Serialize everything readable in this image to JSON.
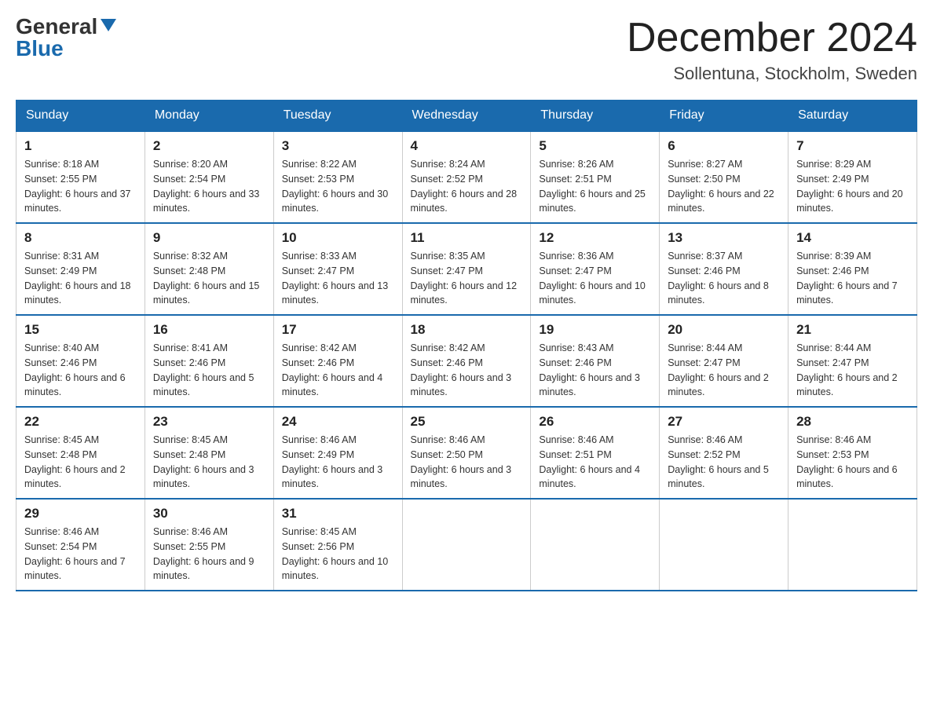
{
  "header": {
    "logo_general": "General",
    "logo_blue": "Blue",
    "month_title": "December 2024",
    "location": "Sollentuna, Stockholm, Sweden"
  },
  "weekdays": [
    "Sunday",
    "Monday",
    "Tuesday",
    "Wednesday",
    "Thursday",
    "Friday",
    "Saturday"
  ],
  "weeks": [
    [
      {
        "day": "1",
        "sunrise": "8:18 AM",
        "sunset": "2:55 PM",
        "daylight": "6 hours and 37 minutes."
      },
      {
        "day": "2",
        "sunrise": "8:20 AM",
        "sunset": "2:54 PM",
        "daylight": "6 hours and 33 minutes."
      },
      {
        "day": "3",
        "sunrise": "8:22 AM",
        "sunset": "2:53 PM",
        "daylight": "6 hours and 30 minutes."
      },
      {
        "day": "4",
        "sunrise": "8:24 AM",
        "sunset": "2:52 PM",
        "daylight": "6 hours and 28 minutes."
      },
      {
        "day": "5",
        "sunrise": "8:26 AM",
        "sunset": "2:51 PM",
        "daylight": "6 hours and 25 minutes."
      },
      {
        "day": "6",
        "sunrise": "8:27 AM",
        "sunset": "2:50 PM",
        "daylight": "6 hours and 22 minutes."
      },
      {
        "day": "7",
        "sunrise": "8:29 AM",
        "sunset": "2:49 PM",
        "daylight": "6 hours and 20 minutes."
      }
    ],
    [
      {
        "day": "8",
        "sunrise": "8:31 AM",
        "sunset": "2:49 PM",
        "daylight": "6 hours and 18 minutes."
      },
      {
        "day": "9",
        "sunrise": "8:32 AM",
        "sunset": "2:48 PM",
        "daylight": "6 hours and 15 minutes."
      },
      {
        "day": "10",
        "sunrise": "8:33 AM",
        "sunset": "2:47 PM",
        "daylight": "6 hours and 13 minutes."
      },
      {
        "day": "11",
        "sunrise": "8:35 AM",
        "sunset": "2:47 PM",
        "daylight": "6 hours and 12 minutes."
      },
      {
        "day": "12",
        "sunrise": "8:36 AM",
        "sunset": "2:47 PM",
        "daylight": "6 hours and 10 minutes."
      },
      {
        "day": "13",
        "sunrise": "8:37 AM",
        "sunset": "2:46 PM",
        "daylight": "6 hours and 8 minutes."
      },
      {
        "day": "14",
        "sunrise": "8:39 AM",
        "sunset": "2:46 PM",
        "daylight": "6 hours and 7 minutes."
      }
    ],
    [
      {
        "day": "15",
        "sunrise": "8:40 AM",
        "sunset": "2:46 PM",
        "daylight": "6 hours and 6 minutes."
      },
      {
        "day": "16",
        "sunrise": "8:41 AM",
        "sunset": "2:46 PM",
        "daylight": "6 hours and 5 minutes."
      },
      {
        "day": "17",
        "sunrise": "8:42 AM",
        "sunset": "2:46 PM",
        "daylight": "6 hours and 4 minutes."
      },
      {
        "day": "18",
        "sunrise": "8:42 AM",
        "sunset": "2:46 PM",
        "daylight": "6 hours and 3 minutes."
      },
      {
        "day": "19",
        "sunrise": "8:43 AM",
        "sunset": "2:46 PM",
        "daylight": "6 hours and 3 minutes."
      },
      {
        "day": "20",
        "sunrise": "8:44 AM",
        "sunset": "2:47 PM",
        "daylight": "6 hours and 2 minutes."
      },
      {
        "day": "21",
        "sunrise": "8:44 AM",
        "sunset": "2:47 PM",
        "daylight": "6 hours and 2 minutes."
      }
    ],
    [
      {
        "day": "22",
        "sunrise": "8:45 AM",
        "sunset": "2:48 PM",
        "daylight": "6 hours and 2 minutes."
      },
      {
        "day": "23",
        "sunrise": "8:45 AM",
        "sunset": "2:48 PM",
        "daylight": "6 hours and 3 minutes."
      },
      {
        "day": "24",
        "sunrise": "8:46 AM",
        "sunset": "2:49 PM",
        "daylight": "6 hours and 3 minutes."
      },
      {
        "day": "25",
        "sunrise": "8:46 AM",
        "sunset": "2:50 PM",
        "daylight": "6 hours and 3 minutes."
      },
      {
        "day": "26",
        "sunrise": "8:46 AM",
        "sunset": "2:51 PM",
        "daylight": "6 hours and 4 minutes."
      },
      {
        "day": "27",
        "sunrise": "8:46 AM",
        "sunset": "2:52 PM",
        "daylight": "6 hours and 5 minutes."
      },
      {
        "day": "28",
        "sunrise": "8:46 AM",
        "sunset": "2:53 PM",
        "daylight": "6 hours and 6 minutes."
      }
    ],
    [
      {
        "day": "29",
        "sunrise": "8:46 AM",
        "sunset": "2:54 PM",
        "daylight": "6 hours and 7 minutes."
      },
      {
        "day": "30",
        "sunrise": "8:46 AM",
        "sunset": "2:55 PM",
        "daylight": "6 hours and 9 minutes."
      },
      {
        "day": "31",
        "sunrise": "8:45 AM",
        "sunset": "2:56 PM",
        "daylight": "6 hours and 10 minutes."
      },
      null,
      null,
      null,
      null
    ]
  ]
}
